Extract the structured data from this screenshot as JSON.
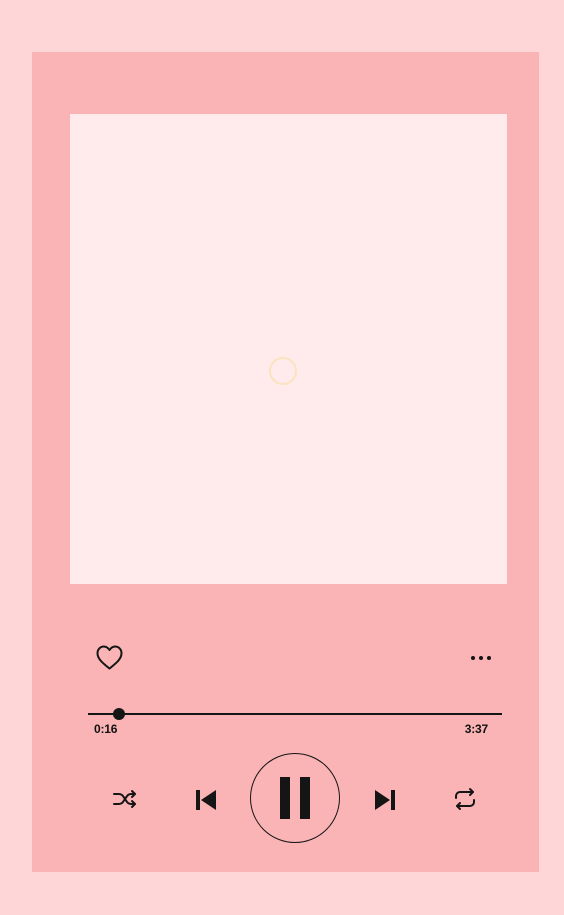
{
  "colors": {
    "page_background": "#ffd6d8",
    "player_background": "#fbb4b6",
    "artwork_background": "#ffebec",
    "spinner": "#fbe3bf",
    "controls": "#151515"
  },
  "artwork": {
    "state": "loading",
    "icon": "loading-spinner"
  },
  "actions": {
    "like_icon": "heart-outline-icon",
    "more_icon": "more-options-icon"
  },
  "progress": {
    "current_time": "0:16",
    "total_time": "3:37",
    "current_seconds": 16,
    "total_seconds": 217
  },
  "controls": {
    "shuffle_icon": "shuffle-icon",
    "previous_icon": "previous-track-icon",
    "pause_icon": "pause-icon",
    "next_icon": "next-track-icon",
    "repeat_icon": "repeat-icon"
  }
}
